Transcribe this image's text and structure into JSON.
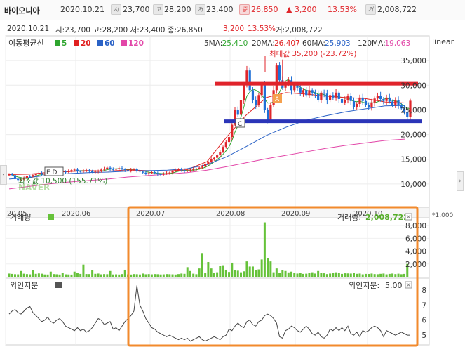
{
  "header": {
    "name": "바이오니아",
    "date": "2020.10.21",
    "open": "23,700",
    "high": "28,200",
    "low": "23,400",
    "close": "26,850",
    "change": "▲ 3,200",
    "change_pct": "13.53%",
    "volume": "2,008,722",
    "icons": {
      "open": "시",
      "high": "고",
      "low": "저",
      "close": "종",
      "volume": "거"
    }
  },
  "info_line": {
    "date": "2020.10.21",
    "ohlc": "시:23,700  고:28,200  저:23,400  종:26,850",
    "change": "3,200",
    "pct": "13.53%",
    "volume": "거:2,008,722"
  },
  "ma_legend": {
    "title": "이동평균선",
    "items": [
      {
        "label": "5",
        "color": "#2ea52e"
      },
      {
        "label": "20",
        "color": "#e02020"
      },
      {
        "label": "60",
        "color": "#2a62c6"
      },
      {
        "label": "120",
        "color": "#e246a8"
      }
    ]
  },
  "ma_values": [
    {
      "label": "5MA:",
      "value": "25,410",
      "color": "#2ea52e"
    },
    {
      "label": "20MA:",
      "value": "26,407",
      "color": "#e02020"
    },
    {
      "label": "60MA:",
      "value": "25,903",
      "color": "#2a62c6"
    },
    {
      "label": "120MA:",
      "value": "19,063",
      "color": "#e246a8"
    }
  ],
  "scale_label": "linear",
  "annotations": {
    "max": "최대값 35,200 (-23.72%)",
    "min": "최소값 10,500 (155.71%)",
    "marker_a": "A",
    "marker_c": "C",
    "marker_ed": "E D",
    "watermark": "NAVER"
  },
  "volume_panel": {
    "title": "거래량",
    "value_label": "거래량:",
    "value": "2,008,722",
    "scale_note": "*1,000"
  },
  "foreign_panel": {
    "title": "외인지분",
    "value_label": "외인지분:",
    "value": "5.00"
  },
  "colors": {
    "up": "#e0262b",
    "down": "#1f6fd6",
    "volume": "#66c23a",
    "overlay_red": "#e0232b",
    "overlay_blue": "#2b35b8",
    "box": "#f28a2c"
  },
  "chart_data": [
    {
      "type": "candlestick",
      "x_ticks": [
        "20.05",
        "2020.06",
        "2020.07",
        "2020.08",
        "2020.09",
        "2020.10"
      ],
      "y_ticks": [
        10000,
        15000,
        20000,
        25000,
        30000,
        35000
      ],
      "ylim": [
        6000,
        39000
      ],
      "scale": "linear",
      "closes": [
        12000,
        11800,
        11000,
        10800,
        10900,
        11200,
        11600,
        11500,
        11800,
        12000,
        12200,
        11900,
        12100,
        12400,
        12500,
        12300,
        12600,
        12700,
        12500,
        12400,
        12600,
        12800,
        12900,
        12600,
        12500,
        12700,
        12800,
        12600,
        12400,
        12500,
        12700,
        12900,
        13100,
        13300,
        13000,
        12900,
        13100,
        13200,
        13000,
        12800,
        12600,
        12900,
        13000,
        12700,
        12500,
        12300,
        12100,
        12200,
        12400,
        12200,
        12000,
        11900,
        12100,
        12200,
        12300,
        12600,
        12800,
        13000,
        12800,
        12600,
        12700,
        12900,
        13000,
        13100,
        13300,
        13500,
        14000,
        14500,
        15000,
        15300,
        15800,
        16500,
        17500,
        18500,
        19500,
        22000,
        25000,
        24000,
        27000,
        30000,
        33000,
        29000,
        27000,
        26000,
        28000,
        30000,
        25000,
        23000,
        26000,
        29000,
        34000,
        31000,
        29500,
        30500,
        31000,
        29000,
        30000,
        29500,
        28500,
        29000,
        28000,
        29000,
        28500,
        28200,
        27000,
        28500,
        28300,
        27000,
        28000,
        27500,
        28500,
        27200,
        26500,
        27000,
        27800,
        26800,
        25500,
        26200,
        27500,
        26800,
        26000,
        25500,
        26500,
        27300,
        27900,
        27200,
        26800,
        27500,
        26700,
        26000,
        27000,
        26000,
        25300,
        24500,
        23500,
        26850
      ],
      "overlays": {
        "horizontal_lines": [
          30300,
          22700
        ]
      },
      "moving_averages": [
        {
          "name": "20",
          "values": [
            11900,
            12000,
            12350,
            12500,
            12700,
            12600,
            12850,
            12700,
            12600,
            12900,
            14500,
            19500,
            24000,
            27500,
            28500,
            28200,
            27800,
            27500,
            27300,
            26600,
            26407
          ]
        },
        {
          "name": "60",
          "values": [
            11000,
            11300,
            11800,
            12100,
            12300,
            12400,
            12600,
            12700,
            12800,
            13100,
            13900,
            15500,
            17600,
            19800,
            21500,
            22900,
            23800,
            24600,
            25200,
            25800,
            25903
          ]
        },
        {
          "name": "120",
          "values": [
            9000,
            9500,
            10000,
            10400,
            10700,
            11000,
            11400,
            11700,
            12000,
            12300,
            12800,
            13500,
            14300,
            15100,
            15800,
            16500,
            17200,
            17800,
            18300,
            18800,
            19063
          ]
        }
      ]
    },
    {
      "type": "bar",
      "name": "거래량",
      "y_ticks": [
        2000,
        4000,
        6000,
        8000
      ],
      "ylim": [
        0,
        9000
      ],
      "values": [
        500,
        450,
        400,
        380,
        900,
        480,
        420,
        380,
        1000,
        460,
        520,
        480,
        360,
        350,
        800,
        420,
        390,
        350,
        600,
        380,
        360,
        340,
        800,
        550,
        450,
        1900,
        430,
        420,
        1000,
        460,
        500,
        380,
        420,
        400,
        900,
        360,
        380,
        350,
        420,
        1100,
        380,
        350,
        420,
        400,
        360,
        500,
        390,
        420,
        380,
        420,
        400,
        360,
        380,
        420,
        400,
        380,
        350,
        420,
        500,
        460,
        1500,
        900,
        480,
        400,
        1300,
        3700,
        650,
        2300,
        1300,
        600,
        700,
        1700,
        1800,
        1100,
        750,
        2200,
        1050,
        950,
        700,
        850,
        2400,
        1600,
        1600,
        1100,
        1150,
        2700,
        8500,
        2900,
        2400,
        700,
        1300,
        600,
        1000,
        900,
        680,
        800,
        620,
        500,
        600,
        450,
        480,
        620,
        700,
        500,
        900,
        600,
        540,
        420,
        500,
        560,
        700,
        600,
        450,
        540,
        520,
        500,
        620,
        460,
        500,
        380,
        450,
        440,
        500,
        420,
        400,
        460,
        500,
        380,
        450,
        500,
        420,
        480,
        400,
        450,
        2008
      ],
      "unit_note": "*1,000"
    },
    {
      "type": "line",
      "name": "외인지분",
      "y_ticks": [
        5,
        6,
        7,
        8
      ],
      "ylim": [
        4.4,
        8.6
      ],
      "values": [
        6.4,
        6.6,
        6.7,
        6.5,
        6.4,
        6.6,
        6.8,
        6.9,
        6.5,
        6.3,
        6.1,
        5.9,
        6.0,
        6.2,
        5.9,
        5.8,
        6.0,
        6.1,
        5.9,
        5.6,
        5.5,
        5.4,
        5.3,
        5.5,
        5.3,
        5.4,
        5.2,
        5.3,
        5.5,
        5.8,
        6.1,
        6.0,
        5.7,
        5.8,
        5.9,
        5.4,
        5.5,
        5.3,
        5.6,
        5.9,
        6.1,
        6.3,
        6.6,
        8.3,
        7.0,
        6.6,
        6.1,
        5.8,
        5.5,
        5.4,
        5.2,
        5.1,
        5.0,
        4.9,
        5.0,
        4.9,
        4.8,
        4.7,
        4.8,
        4.7,
        4.8,
        4.6,
        4.7,
        4.8,
        4.9,
        4.7,
        4.6,
        4.7,
        4.8,
        4.9,
        4.8,
        4.7,
        4.9,
        5.0,
        5.4,
        5.3,
        5.6,
        5.8,
        5.6,
        5.5,
        5.9,
        6.0,
        5.7,
        5.6,
        5.9,
        6.0,
        6.3,
        6.4,
        6.3,
        6.1,
        5.8,
        4.9,
        4.8,
        5.3,
        5.4,
        5.6,
        5.5,
        5.3,
        5.2,
        5.4,
        5.6,
        5.4,
        5.1,
        5.0,
        5.2,
        4.9,
        4.8,
        5.0,
        5.4,
        5.3,
        5.5,
        5.3,
        5.5,
        5.3,
        5.6,
        5.1,
        5.0,
        5.2,
        4.9,
        5.3,
        5.2,
        5.3,
        5.5,
        5.6,
        5.5,
        5.3,
        4.9,
        5.3,
        5.2,
        5.1,
        5.0,
        5.1,
        5.2,
        5.1,
        5.0,
        5.0
      ]
    }
  ]
}
